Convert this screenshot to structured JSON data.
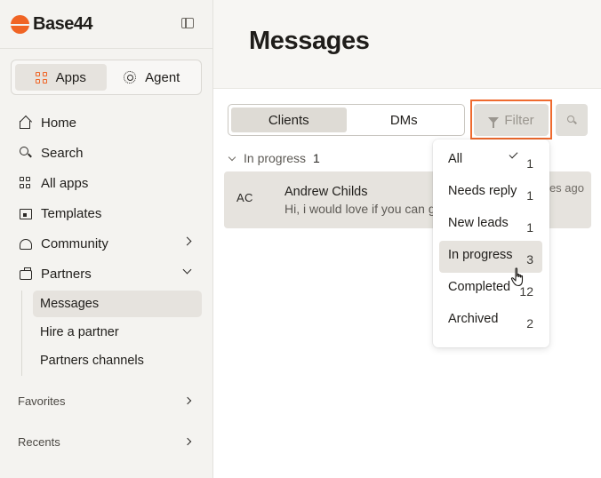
{
  "brand": {
    "name": "Base44",
    "accent": "#f06424"
  },
  "sidebar": {
    "mode_tabs": [
      {
        "label": "Apps",
        "icon": "apps-icon",
        "active": true
      },
      {
        "label": "Agent",
        "icon": "agent-icon",
        "active": false
      }
    ],
    "items": [
      {
        "label": "Home",
        "icon": "home-icon"
      },
      {
        "label": "Search",
        "icon": "search-icon"
      },
      {
        "label": "All apps",
        "icon": "grid-icon"
      },
      {
        "label": "Templates",
        "icon": "templates-icon"
      },
      {
        "label": "Community",
        "icon": "community-icon",
        "chevron": "right"
      },
      {
        "label": "Partners",
        "icon": "briefcase-icon",
        "chevron": "down"
      }
    ],
    "partners_sub": [
      {
        "label": "Messages",
        "active": true
      },
      {
        "label": "Hire a partner"
      },
      {
        "label": "Partners channels"
      }
    ],
    "sections": [
      {
        "label": "Favorites"
      },
      {
        "label": "Recents"
      }
    ]
  },
  "main": {
    "title": "Messages",
    "tabs": [
      {
        "label": "Clients",
        "active": true
      },
      {
        "label": "DMs",
        "active": false
      }
    ],
    "filter_label": "Filter",
    "group": {
      "label": "In progress",
      "count": "1"
    },
    "conversations": [
      {
        "initials": "AC",
        "name": "Andrew Childs",
        "preview": "Hi, i would love if you can g",
        "time": "tes ago"
      }
    ]
  },
  "filter_menu": {
    "items": [
      {
        "label": "All",
        "count": "1",
        "selected": true
      },
      {
        "label": "Needs reply",
        "count": "1"
      },
      {
        "label": "New leads",
        "count": "1"
      },
      {
        "label": "In progress",
        "count": "3",
        "hovered": true
      },
      {
        "label": "Completed",
        "count": "12"
      },
      {
        "label": "Archived",
        "count": "2"
      }
    ]
  }
}
